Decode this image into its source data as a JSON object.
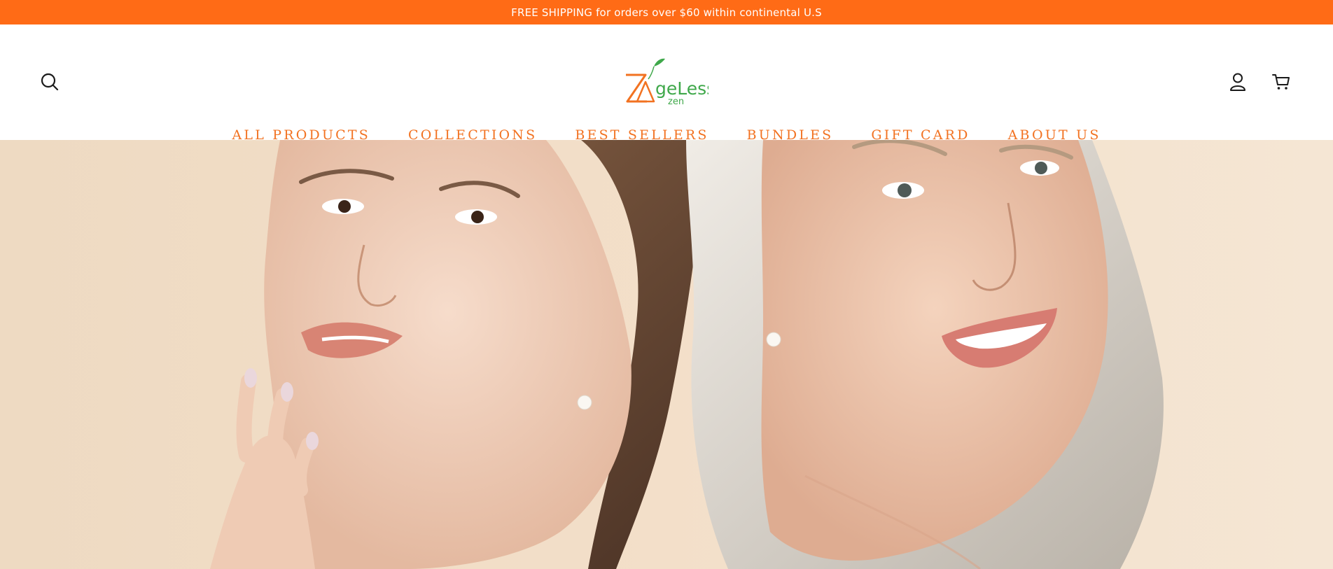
{
  "announcement": {
    "text": "FREE SHIPPING for orders over $60 within continental U.S"
  },
  "header": {
    "logo": {
      "brand": "AgeLess",
      "sub": "zen"
    },
    "icons": {
      "search": "search-icon",
      "account": "account-icon",
      "cart": "cart-icon"
    }
  },
  "nav": {
    "items": [
      {
        "label": "ALL PRODUCTS"
      },
      {
        "label": "COLLECTIONS"
      },
      {
        "label": "BEST SELLERS"
      },
      {
        "label": "BUNDLES"
      },
      {
        "label": "GIFT CARD"
      },
      {
        "label": "ABOUT US"
      }
    ]
  },
  "colors": {
    "accent": "#ff6b16",
    "nav_text": "#f27221",
    "logo_green": "#3fa84a",
    "hero_bg": "#f3dfc7"
  }
}
